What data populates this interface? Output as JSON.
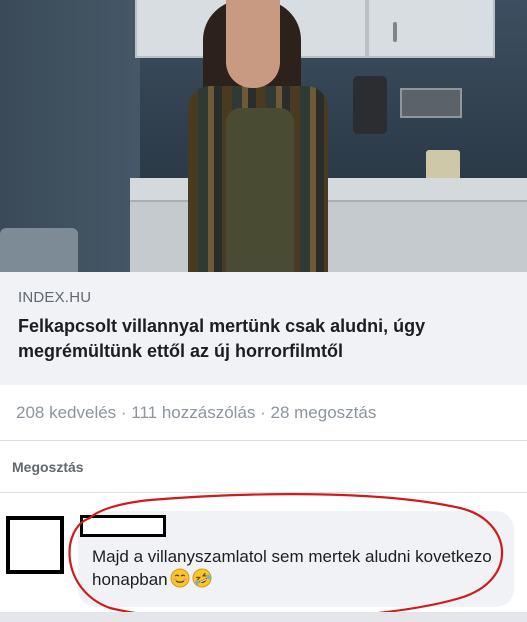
{
  "post": {
    "image": {
      "description_icon": "photo-woman-kitchen"
    },
    "link": {
      "domain": "INDEX.HU",
      "title": "Felkapcsolt villannyal mertünk csak aludni, úgy megrémültünk ettől az új horrorfilmtől"
    },
    "stats": {
      "text": "208 kedvelés · 111 hozzászólás · 28 megosztás"
    }
  },
  "shares": {
    "label": "Megosztás"
  },
  "comment": {
    "text": "Majd a villanyszamlatol sem mertek aludni kovetkezo honapban",
    "emojis": [
      "relieved-face-emoji",
      "rolling-laughing-emoji"
    ]
  },
  "colors": {
    "card_bg": "#f0f2f5",
    "text_primary": "#1c1e21",
    "text_secondary": "#606770",
    "annotation_red": "#d11a1a"
  }
}
